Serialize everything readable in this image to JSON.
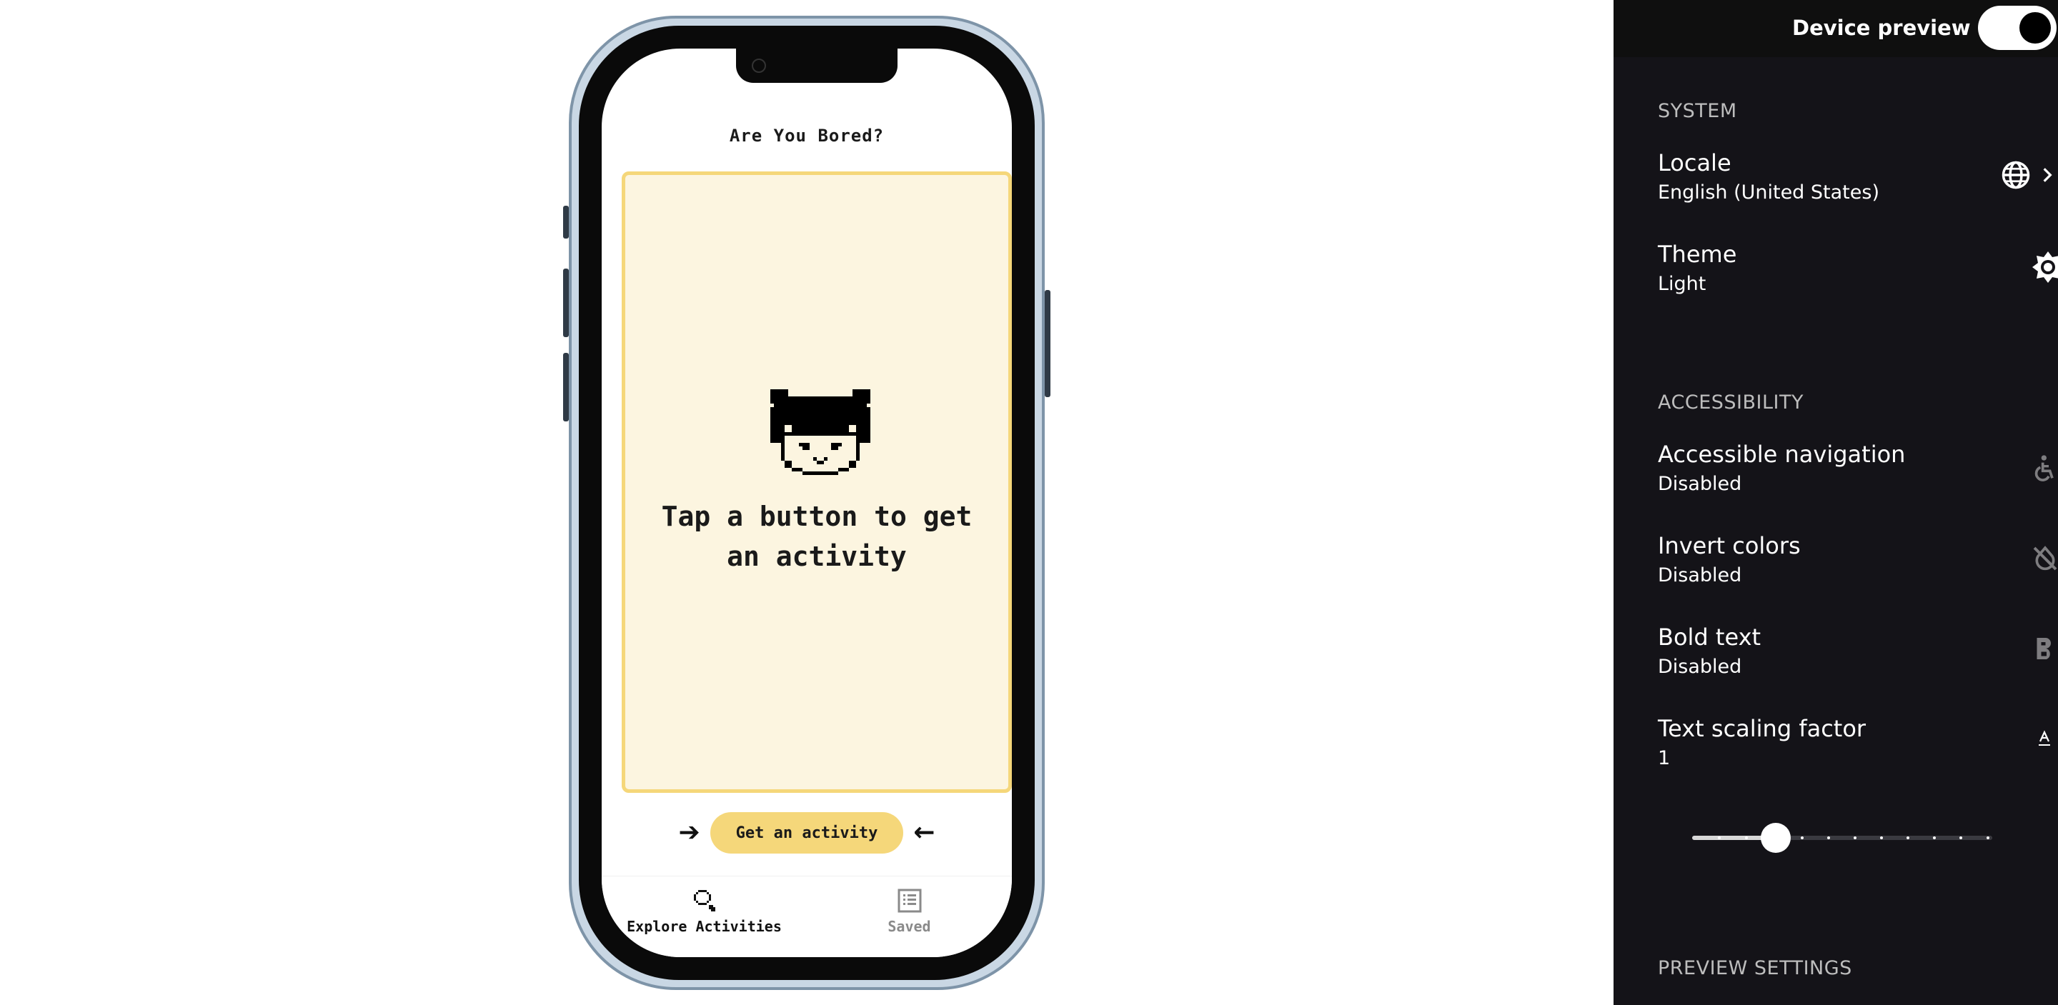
{
  "app": {
    "title": "Are You Bored?",
    "card_message": "Tap a button to get an activity",
    "get_button_label": "Get an activity",
    "arrow_left_glyph": "➔",
    "arrow_right_glyph": "←",
    "nav": [
      {
        "label": "Explore Activities",
        "icon": "search-icon",
        "active": true
      },
      {
        "label": "Saved",
        "icon": "list-icon",
        "active": false
      }
    ],
    "colors": {
      "accent": "#f5d77a",
      "card_bg": "#fcf5e0"
    }
  },
  "panel": {
    "header_label": "Device preview",
    "toggle_on": true,
    "system_title": "SYSTEM",
    "locale": {
      "label": "Locale",
      "value": "English (United States)",
      "icon": "globe-icon"
    },
    "theme": {
      "label": "Theme",
      "value": "Light",
      "icon": "brightness-icon"
    },
    "accessibility_title": "ACCESSIBILITY",
    "accessible_navigation": {
      "label": "Accessible navigation",
      "value": "Disabled",
      "icon": "accessibility-icon"
    },
    "invert_colors": {
      "label": "Invert colors",
      "value": "Disabled",
      "icon": "invert-colors-off-icon"
    },
    "bold_text": {
      "label": "Bold text",
      "value": "Disabled",
      "icon": "bold-icon"
    },
    "text_scaling": {
      "label": "Text scaling factor",
      "value": "1",
      "icon": "text-size-icon"
    },
    "preview_settings_title": "PREVIEW SETTINGS"
  }
}
